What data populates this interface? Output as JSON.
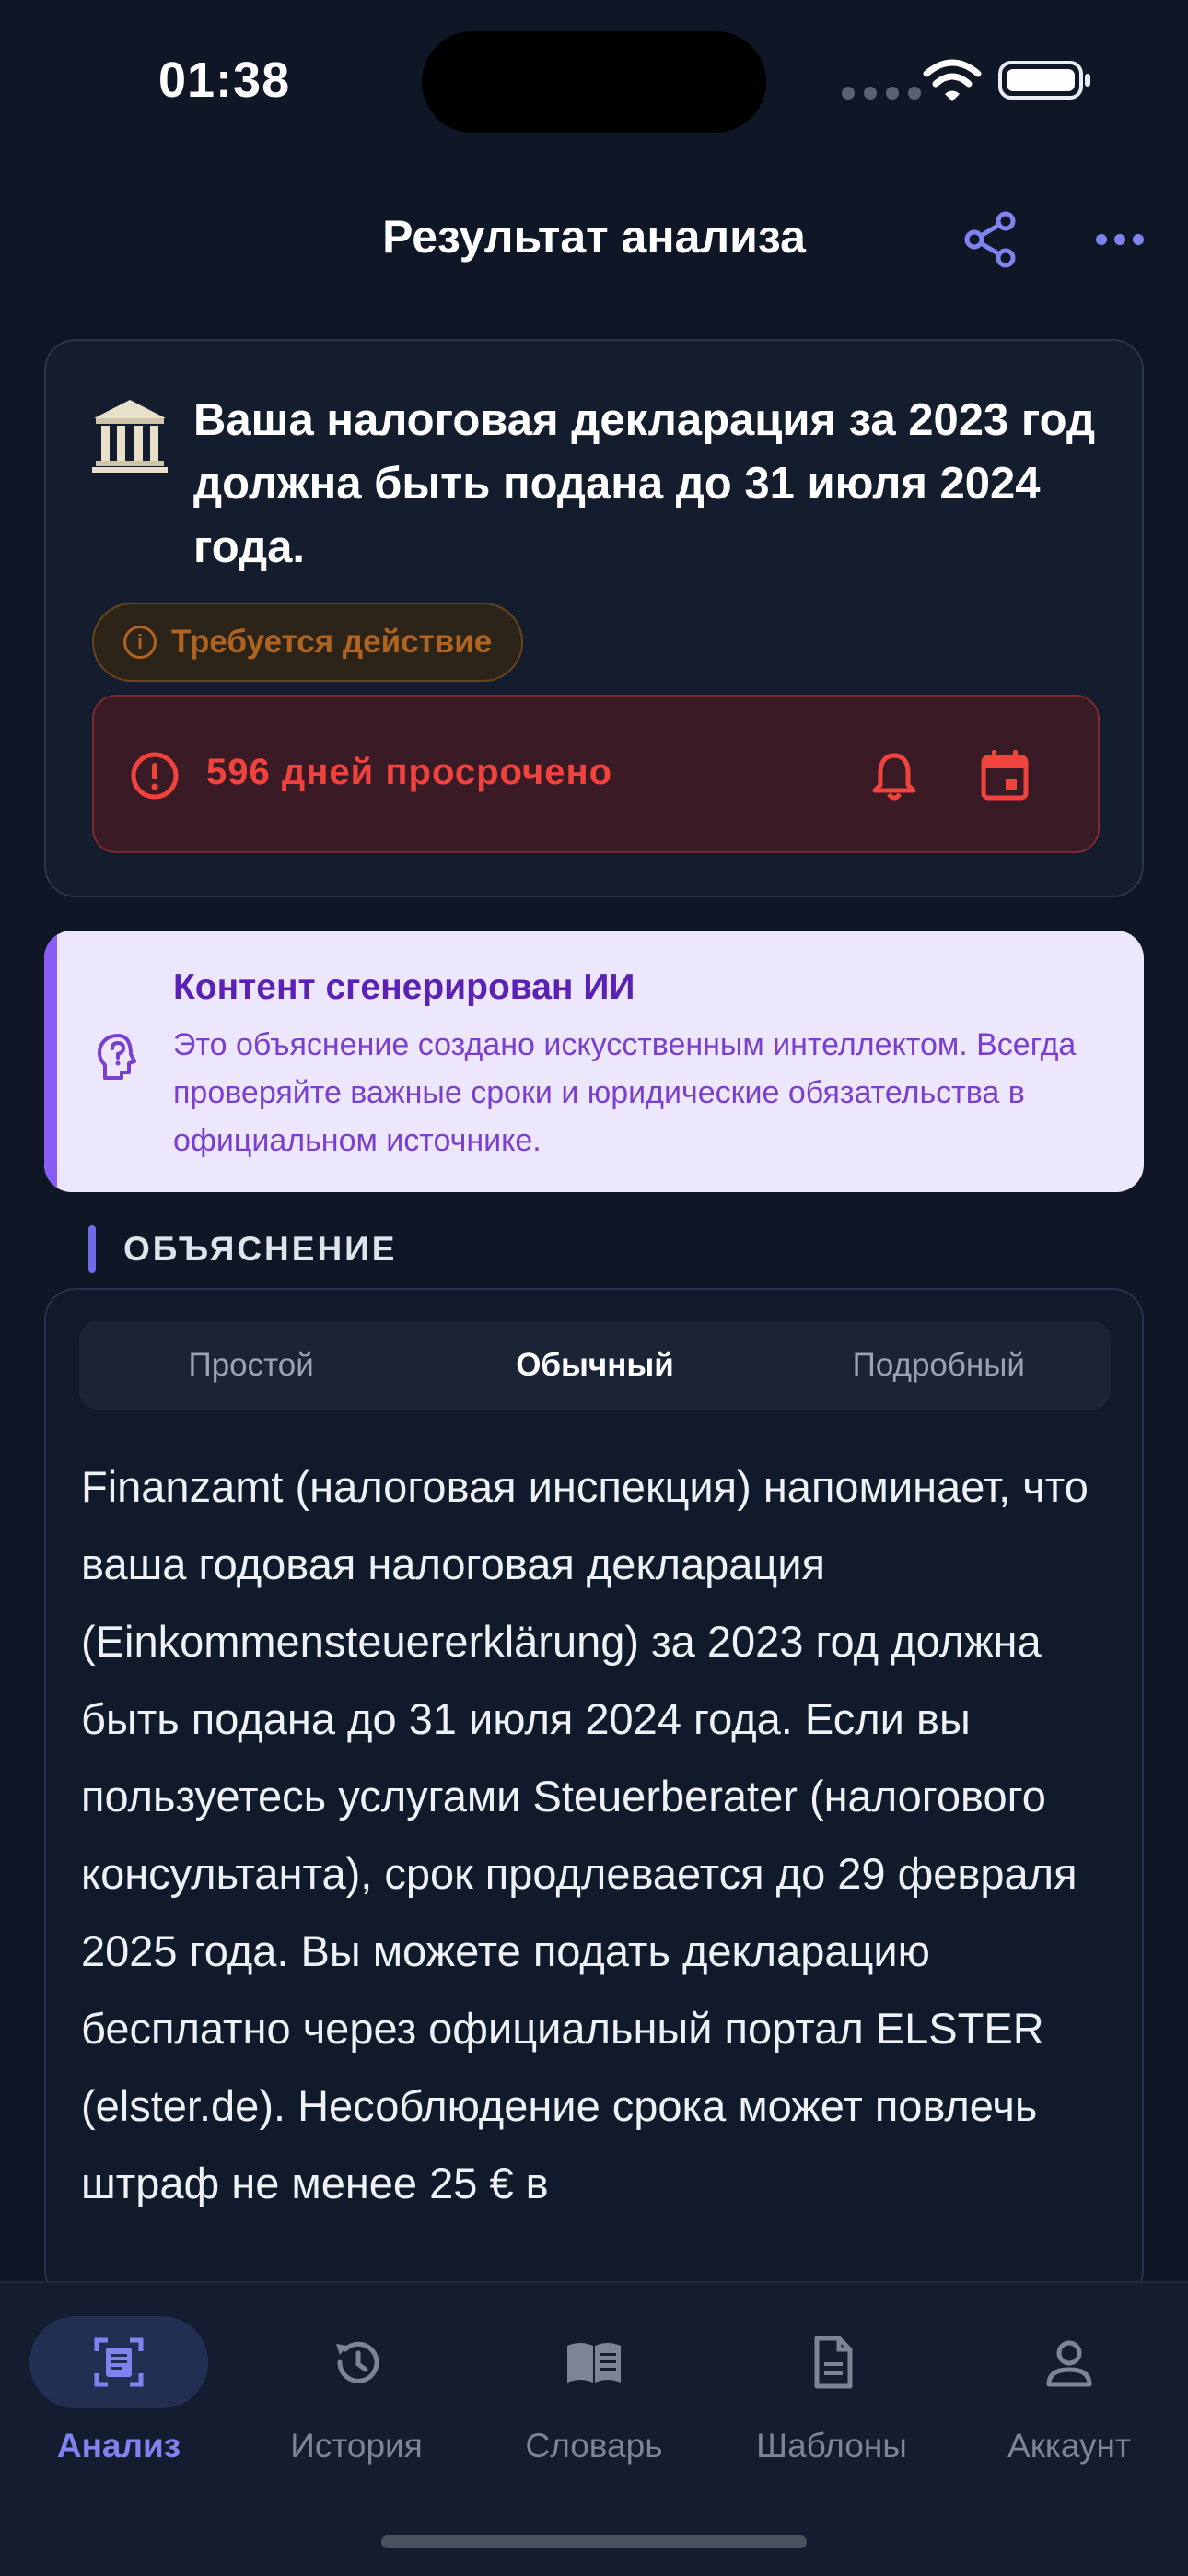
{
  "status_bar": {
    "time": "01:38"
  },
  "header": {
    "title": "Результат анализа"
  },
  "deadline": {
    "title": "Ваша налоговая декларация за 2023 год должна быть подана до 31 июля 2024 года.",
    "badge": "Требуется действие",
    "overdue_text": "596 дней просрочено"
  },
  "ai_notice": {
    "title": "Контент сгенерирован ИИ",
    "body": "Это объяснение создано искусственным интеллектом. Всегда проверяйте важные сроки и юридические обязательства в официальном источнике."
  },
  "section": {
    "label": "ОБЪЯСНЕНИЕ"
  },
  "explanation": {
    "levels": [
      "Простой",
      "Обычный",
      "Подробный"
    ],
    "selected": "Обычный",
    "text": "Finanzamt (налоговая инспекция) напоминает, что ваша годовая налоговая декларация (Einkommensteuererklärung) за 2023 год должна быть подана до 31 июля 2024 года. Если вы пользуетесь услугами Steuerberater (налогового консультанта), срок продлевается до 29 февраля 2025 года. Вы можете подать декларацию бесплатно через официальный портал ELSTER (elster.de). Несоблюдение срока может повлечь штраф не менее 25 € в"
  },
  "nav": {
    "items": [
      {
        "label": "Анализ",
        "icon": "scan-document-icon"
      },
      {
        "label": "История",
        "icon": "history-icon"
      },
      {
        "label": "Словарь",
        "icon": "book-icon"
      },
      {
        "label": "Шаблоны",
        "icon": "document-template-icon"
      },
      {
        "label": "Аккаунт",
        "icon": "account-icon"
      }
    ],
    "active": "Анализ"
  },
  "colors": {
    "background": "#0f1726",
    "accent": "#7f83f0",
    "danger": "#f0433e",
    "warning": "#b0641f",
    "ai_purple": "#5b21b6"
  }
}
